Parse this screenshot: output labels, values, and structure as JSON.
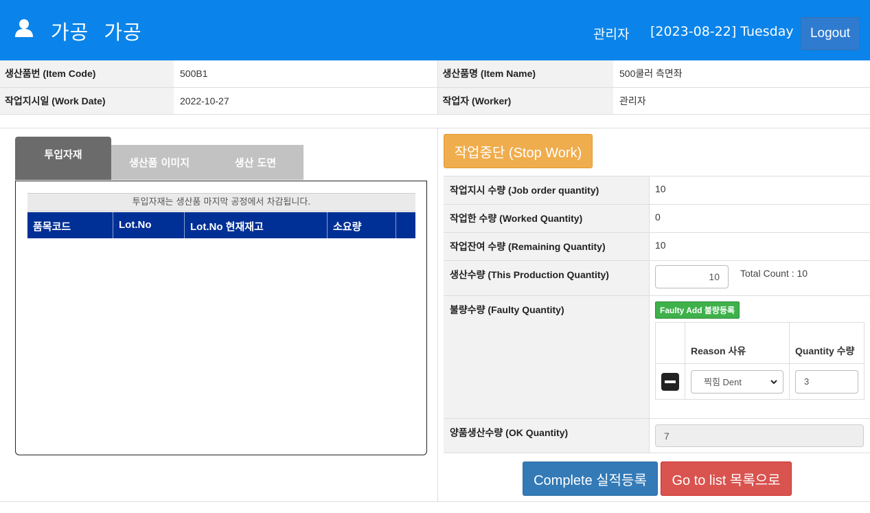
{
  "header": {
    "title_part1": "가공",
    "title_part2": "가공",
    "user": "관리자",
    "date": "[2023-08-22] Tuesday",
    "logout_label": "Logout"
  },
  "info": {
    "item_code_label": "생산품번 (Item Code)",
    "item_code": "500B1",
    "item_name_label": "생산품명 (Item Name)",
    "item_name": "500쿨러 측면좌",
    "work_date_label": "작업지시일 (Work Date)",
    "work_date": "2022-10-27",
    "worker_label": "작업자 (Worker)",
    "worker": "관리자"
  },
  "tabs": [
    "투입자재",
    "생산품 이미지",
    "생산 도면"
  ],
  "materials": {
    "note": "투입자재는 생산품 마지막 공정에서 차감됩니다.",
    "columns": [
      "품목코드",
      "Lot.No",
      "Lot.No 현재재고",
      "소요량",
      ""
    ]
  },
  "stop_label": "작업중단 (Stop Work)",
  "quantities": {
    "job_order_label": "작업지시 수량 (Job order quantity)",
    "job_order": "10",
    "worked_label": "작업한 수량 (Worked Quantity)",
    "worked": "0",
    "remaining_label": "작업잔여 수량 (Remaining Quantity)",
    "remaining": "10",
    "production_label": "생산수량 (This Production Quantity)",
    "production": "10",
    "total_count": "Total Count : 10",
    "faulty_label": "불량수량 (Faulty Quantity)",
    "faulty_add": "Faulty Add 불량등록",
    "reason_header": "Reason 사유",
    "quantity_header": "Quantity 수량",
    "reason_value": "찍힘 Dent",
    "faulty_qty": "3",
    "ok_label": "양품생산수량 (OK Quantity)",
    "ok_value": "7"
  },
  "actions": {
    "complete": "Complete 실적등록",
    "go_list": "Go to list 목록으로"
  },
  "colors": {
    "header_bg": "#0a84ea",
    "table_head": "#002f95",
    "stop": "#f0ad4e",
    "complete": "#337ab7",
    "go_list": "#d9534f",
    "faulty_add": "#3fb14b"
  }
}
